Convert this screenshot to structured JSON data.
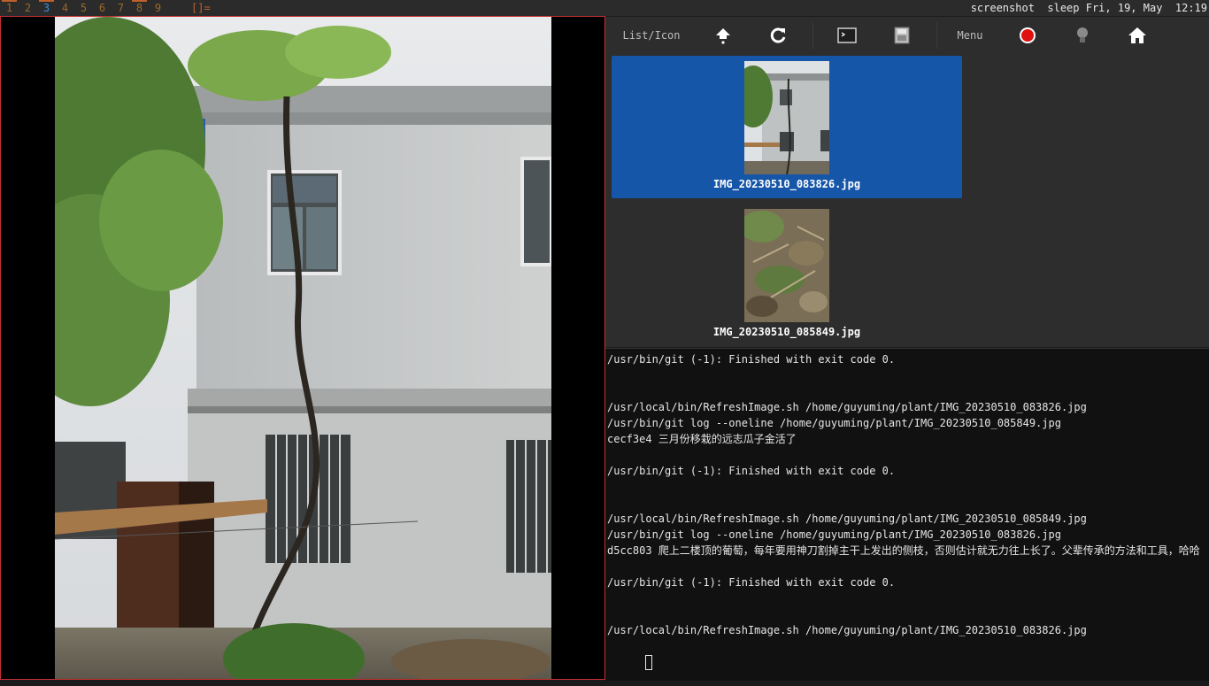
{
  "topbar": {
    "workspaces": [
      {
        "label": "1",
        "occupied": true,
        "active": false
      },
      {
        "label": "2",
        "occupied": false,
        "active": false
      },
      {
        "label": "3",
        "occupied": true,
        "active": true
      },
      {
        "label": "4",
        "occupied": false,
        "active": false
      },
      {
        "label": "5",
        "occupied": false,
        "active": false
      },
      {
        "label": "6",
        "occupied": false,
        "active": false
      },
      {
        "label": "7",
        "occupied": false,
        "active": false
      },
      {
        "label": "8",
        "occupied": true,
        "active": false
      },
      {
        "label": "9",
        "occupied": false,
        "active": false
      }
    ],
    "layout_symbol": "[]=",
    "status_text": "screenshot  sleep Fri, 19, May  12:19"
  },
  "toolbar": {
    "list_icon_label": "List/Icon",
    "menu_label": "Menu",
    "icons": [
      "up-icon",
      "refresh-icon",
      "terminal-icon",
      "save-icon",
      "record-icon",
      "bulb-icon",
      "home-icon"
    ]
  },
  "files": [
    {
      "name": "IMG_20230510_083826.jpg",
      "selected": true
    },
    {
      "name": "IMG_20230510_085849.jpg",
      "selected": false
    }
  ],
  "terminal": {
    "lines": [
      "/usr/bin/git (-1): Finished with exit code 0.",
      "",
      "",
      "/usr/local/bin/RefreshImage.sh /home/guyuming/plant/IMG_20230510_083826.jpg",
      "/usr/bin/git log --oneline /home/guyuming/plant/IMG_20230510_085849.jpg",
      "cecf3e4 三月份移栽的远志瓜子金活了",
      "",
      "/usr/bin/git (-1): Finished with exit code 0.",
      "",
      "",
      "/usr/local/bin/RefreshImage.sh /home/guyuming/plant/IMG_20230510_085849.jpg",
      "/usr/bin/git log --oneline /home/guyuming/plant/IMG_20230510_083826.jpg",
      "d5cc803 爬上二楼顶的葡萄，每年要用神刀割掉主干上发出的侧枝，否则估计就无力往上长了。父辈传承的方法和工具，哈哈",
      "",
      "/usr/bin/git (-1): Finished with exit code 0.",
      "",
      "",
      "/usr/local/bin/RefreshImage.sh /home/guyuming/plant/IMG_20230510_083826.jpg"
    ]
  },
  "colors": {
    "accent_blue": "#1656a8",
    "border_red": "#c83030",
    "workspace_orange": "#c0602a",
    "record_red": "#e01010"
  }
}
